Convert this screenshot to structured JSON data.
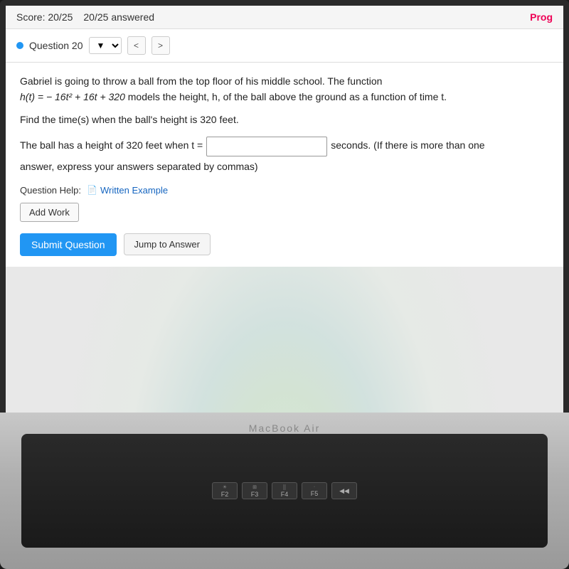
{
  "header": {
    "score_label": "Score: 20/25",
    "answered_label": "20/25 answered",
    "prog_label": "Prog"
  },
  "nav": {
    "question_label": "Question 20",
    "prev_label": "<",
    "next_label": ">"
  },
  "question": {
    "text_line1": "Gabriel is going to throw a ball from the top floor of his middle school. The function",
    "formula": "h(t) = − 16t² + 16t + 320",
    "text_line2": " models the height, h, of the ball above the ground as a function of time t.",
    "find_text": "Find the time(s) when the ball's height is 320 feet.",
    "answer_prefix": "The ball has a height of 320 feet when t =",
    "answer_suffix": "seconds. (If there is more than one",
    "answer_note": "answer, express your answers separated by commas)",
    "input_placeholder": "",
    "help_label": "Question Help:",
    "written_example_label": "Written Example",
    "add_work_label": "Add Work",
    "submit_label": "Submit Question",
    "jump_label": "Jump to Answer"
  },
  "macbook_label": "MacBook Air",
  "keyboard": {
    "keys": [
      {
        "label": "F2",
        "icon": "☀"
      },
      {
        "label": "F3",
        "icon": "⊞"
      },
      {
        "label": "F4",
        "icon": "⣿"
      },
      {
        "label": "F5",
        "icon": "·"
      },
      {
        "label": "◀◀",
        "icon": ""
      }
    ]
  }
}
